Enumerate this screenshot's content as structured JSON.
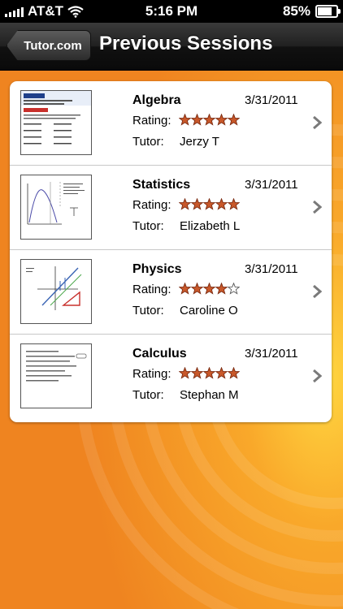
{
  "status_bar": {
    "carrier": "AT&T",
    "time": "5:16 PM",
    "battery": "85%",
    "battery_level": 0.85
  },
  "nav": {
    "back_label": "Tutor.com",
    "title": "Previous Sessions"
  },
  "labels": {
    "rating": "Rating:",
    "tutor": "Tutor:"
  },
  "colors": {
    "background": "#f0891f",
    "star_fill": "#c8582a"
  },
  "sessions": [
    {
      "subject": "Algebra",
      "date": "3/31/2011",
      "rating": 5,
      "tutor": "Jerzy T"
    },
    {
      "subject": "Statistics",
      "date": "3/31/2011",
      "rating": 5,
      "tutor": "Elizabeth L"
    },
    {
      "subject": "Physics",
      "date": "3/31/2011",
      "rating": 4,
      "tutor": "Caroline O"
    },
    {
      "subject": "Calculus",
      "date": "3/31/2011",
      "rating": 5,
      "tutor": "Stephan M"
    }
  ]
}
